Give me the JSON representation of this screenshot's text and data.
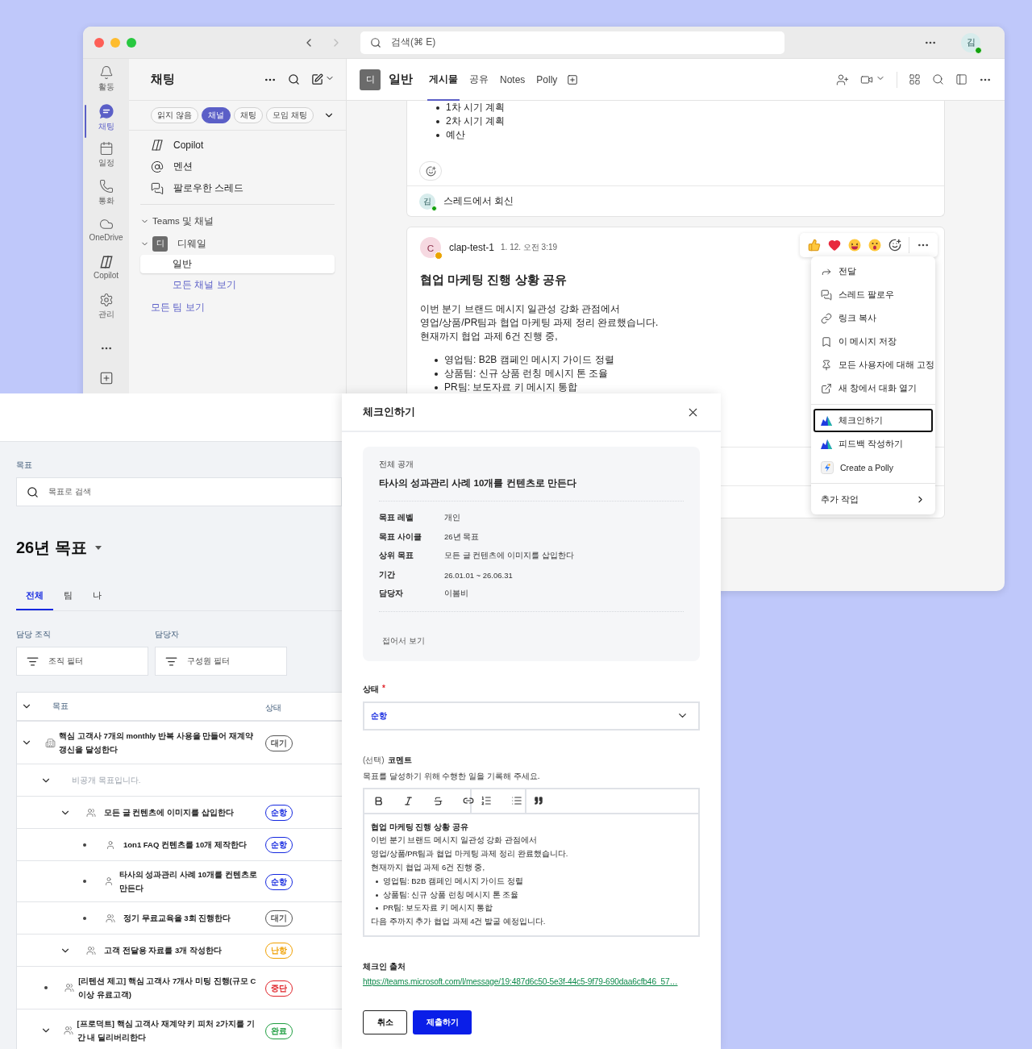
{
  "titlebar": {
    "back_disabled": false,
    "forward_disabled": true,
    "search_placeholder": "검색(⌘ E)",
    "avatar": "김"
  },
  "rail": [
    {
      "label": "활동",
      "selected": false
    },
    {
      "label": "채팅",
      "selected": true
    },
    {
      "label": "일정",
      "selected": false
    },
    {
      "label": "통화",
      "selected": false
    },
    {
      "label": "OneDrive",
      "selected": false
    },
    {
      "label": "Copilot",
      "selected": false
    },
    {
      "label": "관리",
      "selected": false
    }
  ],
  "chat_pane": {
    "title": "채팅",
    "filters": [
      {
        "label": "읽지 않음",
        "selected": false
      },
      {
        "label": "채널",
        "selected": true
      },
      {
        "label": "채팅",
        "selected": false
      },
      {
        "label": "모임 채팅",
        "selected": false
      }
    ],
    "shortcuts": [
      "Copilot",
      "멘션",
      "팔로우한 스레드"
    ],
    "section": {
      "label": "Teams 및 채널",
      "expanded": true
    },
    "team": {
      "avatar": "디",
      "name": "디웨일",
      "expanded": true
    },
    "channels": [
      {
        "label": "일반",
        "selected": true
      }
    ],
    "all_channels": "모든 채널 보기",
    "all_teams": "모든 팀 보기"
  },
  "channel_header": {
    "avatar": "디",
    "name": "일반",
    "tabs": [
      {
        "label": "게시물",
        "selected": true
      },
      {
        "label": "공유",
        "selected": false
      },
      {
        "label": "Notes",
        "selected": false
      },
      {
        "label": "Polly",
        "selected": false
      }
    ]
  },
  "earlier_post": {
    "bullets": [
      "1차 시기 계획",
      "2차 시기 계획",
      "예산"
    ],
    "reply_avatar": "김",
    "reply": "스레드에서 회신"
  },
  "message": {
    "avatar": "C",
    "author": "clap-test-1",
    "time": "1. 12. 오전 3:19",
    "title": "협업 마케팅 진행 상황 공유",
    "lines": [
      "이번 분기 브랜드 메시지 일관성 강화 관점에서",
      "영업/상품/PR팀과 협업 마케팅 과제 정리 완료했습니다.",
      "현재까지 협업 과제 6건 진행 중,"
    ],
    "bullets": [
      "영업팀: B2B 캠페인 메시지 가이드 정렬",
      "상품팀: 신규 상품 런칭 메시지 톤 조율",
      "PR팀: 보도자료 키 메시지 통합"
    ]
  },
  "context_menu": {
    "groups": [
      [
        {
          "label": "전달",
          "selected": false
        },
        {
          "label": "스레드 팔로우",
          "selected": false
        },
        {
          "label": "링크 복사",
          "selected": false
        },
        {
          "label": "이 메시지 저장",
          "selected": false
        },
        {
          "label": "모든 사용자에 대해 고정",
          "selected": false
        },
        {
          "label": "새 창에서 대화 열기",
          "selected": false
        }
      ],
      [
        {
          "label": "체크인하기",
          "selected": true
        },
        {
          "label": "피드백 작성하기",
          "selected": false
        },
        {
          "label": "Create a Polly",
          "selected": false
        }
      ],
      [
        {
          "label": "추가 작업",
          "selected": false
        }
      ]
    ]
  },
  "goals": {
    "search_label": "목표",
    "search_placeholder": "목표로 검색",
    "title": "26년 목표",
    "tabs": [
      {
        "label": "전체",
        "selected": true
      },
      {
        "label": "팀",
        "selected": false
      },
      {
        "label": "나",
        "selected": false
      }
    ],
    "filters": [
      {
        "label": "담당 조직",
        "placeholder": "조직 필터"
      },
      {
        "label": "담당자",
        "placeholder": "구성원 필터"
      }
    ],
    "table": {
      "columns": [
        "목표",
        "상태"
      ],
      "rows": [
        {
          "kind": "org",
          "expandable": true,
          "expanded": true,
          "title": "핵심 고객사 7개의 monthly 반복 사용을 만들어 재계약 갱신을 달성한다",
          "status": "대기",
          "color": "#555555",
          "children": [
            {
              "kind": "private",
              "expandable": true,
              "expanded": true,
              "title": "비공개 목표입니다.",
              "children": [
                {
                  "kind": "team",
                  "expandable": true,
                  "expanded": true,
                  "title": "모든 글 컨텐츠에 이미지를 삽입한다",
                  "status": "순항",
                  "color": "#1428e0",
                  "children": [
                    {
                      "kind": "person",
                      "expandable": false,
                      "title": "1on1 FAQ 컨텐츠를 10개 제작한다",
                      "status": "순항",
                      "color": "#1428e0"
                    },
                    {
                      "kind": "person",
                      "expandable": false,
                      "title": "타사의 성과관리 사례 10개를 컨텐츠로 만든다",
                      "status": "순항",
                      "color": "#1428e0"
                    },
                    {
                      "kind": "team",
                      "expandable": false,
                      "title": "정기 무료교육을 3회 진행한다",
                      "status": "대기",
                      "color": "#555555"
                    }
                  ]
                },
                {
                  "kind": "team",
                  "expandable": true,
                  "expanded": true,
                  "title": "고객 전달용 자료를 3개 작성한다",
                  "status": "난항",
                  "color": "#f0a000"
                }
              ]
            },
            {
              "kind": "team",
              "expandable": false,
              "title": "[리텐션 제고] 핵심 고객사 7개사 미팅 진행(규모 C이상 유료고객)",
              "status": "중단",
              "color": "#e0242a"
            },
            {
              "kind": "team",
              "expandable": true,
              "expanded": true,
              "title": "[프로덕트] 핵심 고객사 재계약 키 피처 2가지를 기간 내 딜리버리한다",
              "status": "완료",
              "color": "#1e9e40"
            }
          ]
        }
      ]
    }
  },
  "checkin": {
    "title": "체크인하기",
    "visibility": "전체 공개",
    "goal": "타사의 성과관리 사례 10개를 컨텐츠로 만든다",
    "details": [
      {
        "label": "목표 레벨",
        "value": "개인"
      },
      {
        "label": "목표 사이클",
        "value": "26년 목표"
      },
      {
        "label": "상위 목표",
        "value": "모든 글 컨텐츠에 이미지를 삽입한다"
      },
      {
        "label": "기간",
        "value": "26.01.01 ~ 26.06.31"
      },
      {
        "label": "담당자",
        "value": "이봄비"
      }
    ],
    "collapse": "접어서 보기",
    "status_label": "상태",
    "required_mark": "*",
    "status_value": "순항",
    "comment_optional": "(선택)",
    "comment_label": "코멘트",
    "comment_hint": "목표를 달성하기 위해 수행한 일을 기록해 주세요.",
    "comment_lines": [
      {
        "kind": "heading",
        "text": "협업 마케팅 진행 상황 공유"
      },
      {
        "kind": "text",
        "text": "이번 분기 브랜드 메시지 일관성 강화 관점에서"
      },
      {
        "kind": "text",
        "text": "영업/상품/PR팀과 협업 마케팅 과제 정리 완료했습니다."
      },
      {
        "kind": "text",
        "text": "현재까지 협업 과제 6건 진행 중,"
      },
      {
        "kind": "bullet",
        "text": "영업팀: B2B 캠페인 메시지 가이드 정렬"
      },
      {
        "kind": "bullet",
        "text": "상품팀: 신규 상품 런칭 메시지 톤 조율"
      },
      {
        "kind": "bullet",
        "text": "PR팀: 보도자료 키 메시지 통합"
      },
      {
        "kind": "text",
        "text": "다음 주까지 추가 협업 과제 4건 발굴 예정입니다."
      }
    ],
    "source_label": "체크인 출처",
    "source_link": "https://teams.microsoft.com/l/message/19:487d6c50-5e3f-44c5-9f79-690daa6cfb46_57…",
    "cancel": "취소",
    "submit": "제출하기"
  }
}
